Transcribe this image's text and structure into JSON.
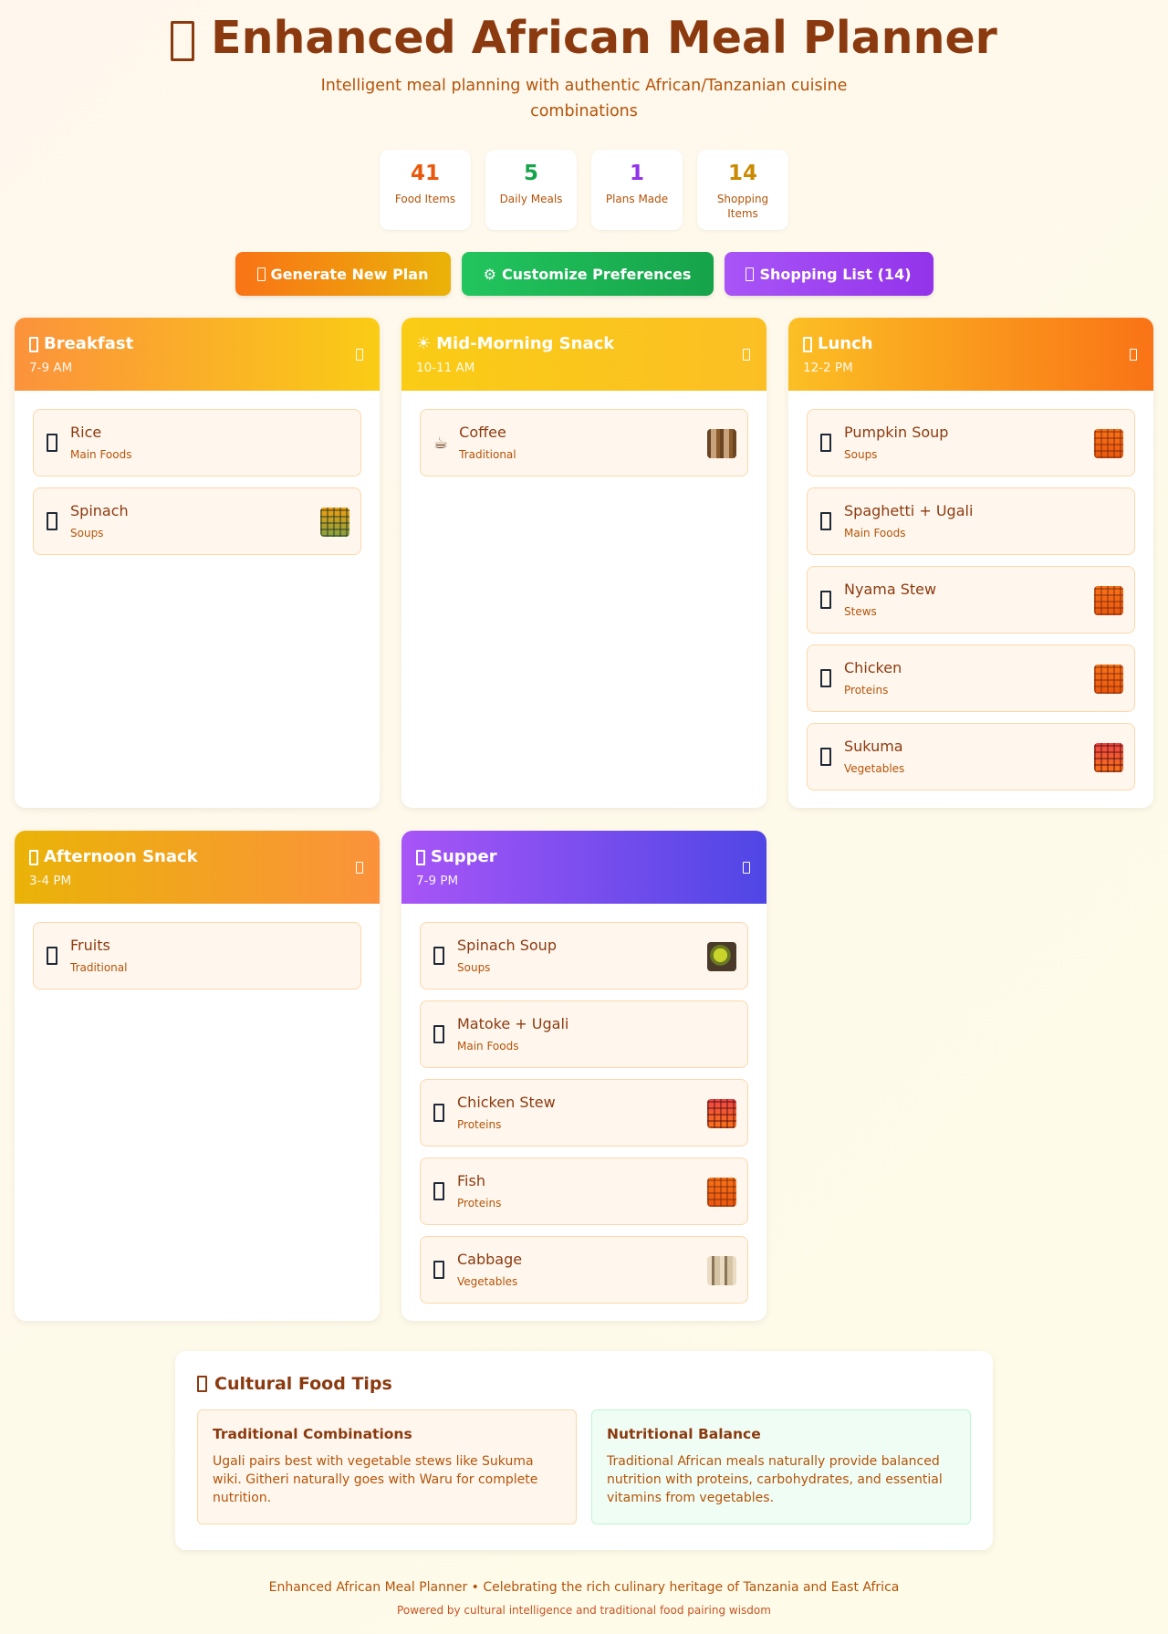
{
  "header": {
    "title": "Enhanced African Meal Planner",
    "title_icon": "african-food-emoji",
    "subtitle": "Intelligent meal planning with authentic African/Tanzanian cuisine combinations"
  },
  "stats": [
    {
      "value": "41",
      "label": "Food Items",
      "color": "#ea580c"
    },
    {
      "value": "5",
      "label": "Daily Meals",
      "color": "#16a34a"
    },
    {
      "value": "1",
      "label": "Plans Made",
      "color": "#9333ea"
    },
    {
      "value": "14",
      "label": "Shopping Items",
      "color": "#ca8a04"
    }
  ],
  "actions": {
    "generate": "Generate New Plan",
    "customize": "Customize Preferences",
    "shopping": "Shopping List (14)",
    "customize_icon": "⚙"
  },
  "meals": [
    {
      "title": "Breakfast",
      "time": "7-9 AM",
      "items": [
        {
          "name": "Rice",
          "category": "Main Foods"
        },
        {
          "name": "Spinach",
          "category": "Soups"
        }
      ]
    },
    {
      "title": "Mid-Morning Snack",
      "time": "10-11 AM",
      "icon": "☀",
      "items": [
        {
          "name": "Coffee",
          "category": "Traditional",
          "icon": "☕"
        }
      ]
    },
    {
      "title": "Lunch",
      "time": "12-2 PM",
      "items": [
        {
          "name": "Pumpkin Soup",
          "category": "Soups"
        },
        {
          "name": "Spaghetti + Ugali",
          "category": "Main Foods"
        },
        {
          "name": "Nyama Stew",
          "category": "Stews"
        },
        {
          "name": "Chicken",
          "category": "Proteins"
        },
        {
          "name": "Sukuma",
          "category": "Vegetables"
        }
      ]
    },
    {
      "title": "Afternoon Snack",
      "time": "3-4 PM",
      "items": [
        {
          "name": "Fruits",
          "category": "Traditional"
        }
      ]
    },
    {
      "title": "Supper",
      "time": "7-9 PM",
      "items": [
        {
          "name": "Spinach Soup",
          "category": "Soups"
        },
        {
          "name": "Matoke + Ugali",
          "category": "Main Foods"
        },
        {
          "name": "Chicken Stew",
          "category": "Proteins"
        },
        {
          "name": "Fish",
          "category": "Proteins"
        },
        {
          "name": "Cabbage",
          "category": "Vegetables"
        }
      ]
    }
  ],
  "tips": {
    "title": "Cultural Food Tips",
    "cards": [
      {
        "title": "Traditional Combinations",
        "body": "Ugali pairs best with vegetable stews like Sukuma wiki. Githeri naturally goes with Waru for complete nutrition."
      },
      {
        "title": "Nutritional Balance",
        "body": "Traditional African meals naturally provide balanced nutrition with proteins, carbohydrates, and essential vitamins from vegetables."
      }
    ]
  },
  "footer": {
    "line1": "Enhanced African Meal Planner • Celebrating the rich culinary heritage of Tanzania and East Africa",
    "line2": "Powered by cultural intelligence and traditional food pairing wisdom"
  }
}
